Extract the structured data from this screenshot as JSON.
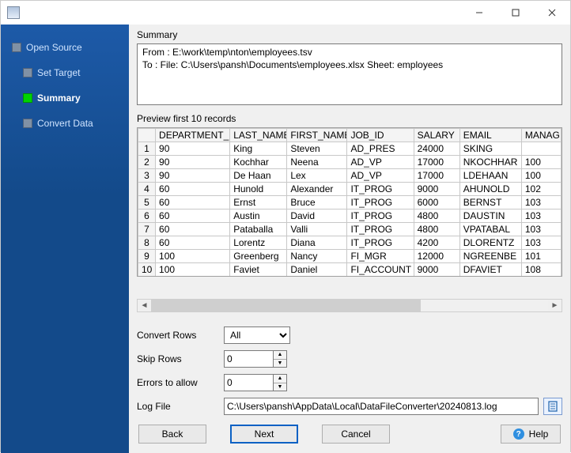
{
  "sidebar": {
    "items": [
      {
        "label": "Open Source",
        "active": false
      },
      {
        "label": "Set Target",
        "active": false
      },
      {
        "label": "Summary",
        "active": true
      },
      {
        "label": "Convert Data",
        "active": false
      }
    ]
  },
  "summary": {
    "heading": "Summary",
    "from": "From : E:\\work\\temp\\nton\\employees.tsv",
    "to": "To : File: C:\\Users\\pansh\\Documents\\employees.xlsx Sheet: employees"
  },
  "preview": {
    "heading": "Preview first 10 records",
    "columns": [
      "DEPARTMENT_ID",
      "LAST_NAME",
      "FIRST_NAME",
      "JOB_ID",
      "SALARY",
      "EMAIL",
      "MANAG"
    ],
    "rows": [
      [
        "90",
        "King",
        "Steven",
        "AD_PRES",
        "24000",
        "SKING",
        ""
      ],
      [
        "90",
        "Kochhar",
        "Neena",
        "AD_VP",
        "17000",
        "NKOCHHAR",
        "100"
      ],
      [
        "90",
        "De Haan",
        "Lex",
        "AD_VP",
        "17000",
        "LDEHAAN",
        "100"
      ],
      [
        "60",
        "Hunold",
        "Alexander",
        "IT_PROG",
        "9000",
        "AHUNOLD",
        "102"
      ],
      [
        "60",
        "Ernst",
        "Bruce",
        "IT_PROG",
        "6000",
        "BERNST",
        "103"
      ],
      [
        "60",
        "Austin",
        "David",
        "IT_PROG",
        "4800",
        "DAUSTIN",
        "103"
      ],
      [
        "60",
        "Pataballa",
        "Valli",
        "IT_PROG",
        "4800",
        "VPATABAL",
        "103"
      ],
      [
        "60",
        "Lorentz",
        "Diana",
        "IT_PROG",
        "4200",
        "DLORENTZ",
        "103"
      ],
      [
        "100",
        "Greenberg",
        "Nancy",
        "FI_MGR",
        "12000",
        "NGREENBE",
        "101"
      ],
      [
        "100",
        "Faviet",
        "Daniel",
        "FI_ACCOUNT",
        "9000",
        "DFAVIET",
        "108"
      ]
    ]
  },
  "settings": {
    "convert_rows_label": "Convert Rows",
    "convert_rows_value": "All",
    "skip_rows_label": "Skip Rows",
    "skip_rows_value": "0",
    "errors_label": "Errors to allow",
    "errors_value": "0",
    "log_label": "Log File",
    "log_value": "C:\\Users\\pansh\\AppData\\Local\\DataFileConverter\\20240813.log"
  },
  "buttons": {
    "back": "Back",
    "next": "Next",
    "cancel": "Cancel",
    "help": "Help"
  }
}
